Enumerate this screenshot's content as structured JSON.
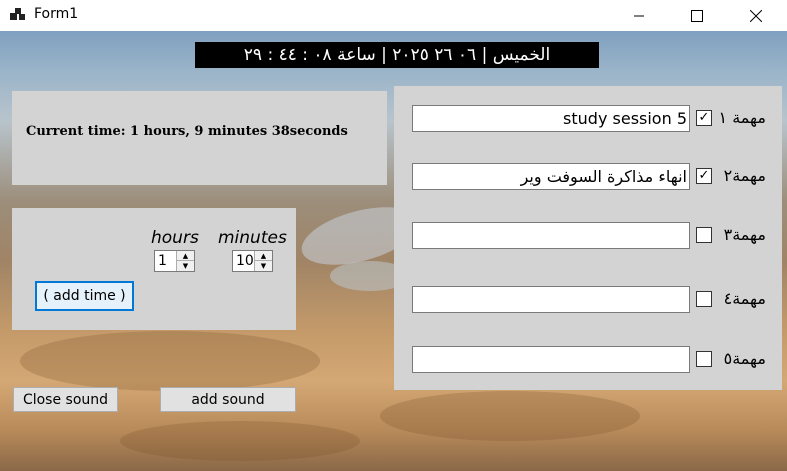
{
  "window": {
    "title": "Form1",
    "minimize": "—",
    "maximize": "☐",
    "close": "✕"
  },
  "clock_display": "الخميس | ٠٦ ٢٦ ٢٠٢٥ | ساعة ٠٨ : ٤٤ : ٢٩",
  "current_time": "Current time: 1 hours, 9 minutes 38seconds",
  "timer": {
    "hours_label": "hours",
    "minutes_label": "minutes",
    "hours_value": "1",
    "minutes_value": "10",
    "add_time_label": "( add time )"
  },
  "buttons": {
    "close_sound": "Close sound",
    "add_sound": "add sound"
  },
  "tasks": [
    {
      "label": "مهمة ١",
      "text": "study session 5",
      "checked": true
    },
    {
      "label": "مهمة٢",
      "text": "انهاء مذاكرة السوفت وير",
      "checked": true
    },
    {
      "label": "مهمة٣",
      "text": "",
      "checked": false
    },
    {
      "label": "مهمة٤",
      "text": "",
      "checked": false
    },
    {
      "label": "مهمة٥",
      "text": "",
      "checked": false
    }
  ],
  "icons": {
    "app": "app-window-icon",
    "check": "✓"
  }
}
